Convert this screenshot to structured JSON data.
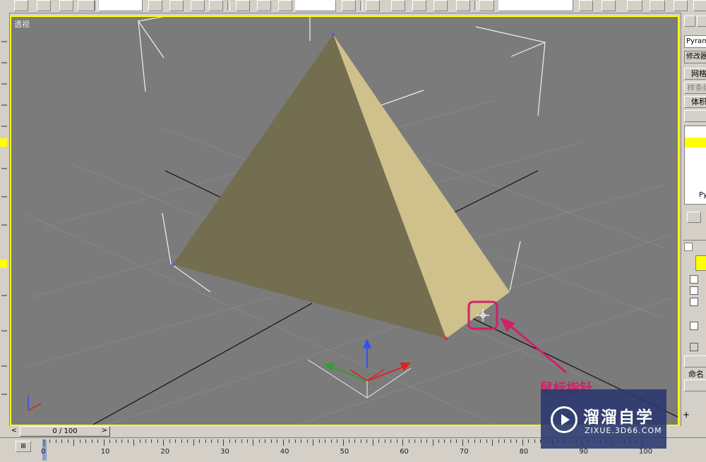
{
  "viewport": {
    "label": "透视"
  },
  "annotation": {
    "text": "鼠标指针"
  },
  "command_panel": {
    "object_name": "Pyramid",
    "modifier_list": "修改器",
    "buttons": [
      "网格",
      "样条线",
      "体积"
    ],
    "list_item": "Py",
    "section_label": "命名",
    "checkbox_labels": [
      "",
      "",
      "",
      "",
      ""
    ]
  },
  "time_slider": {
    "position": "0 / 100",
    "prev_icon": "arrow-left-icon",
    "next_icon": "arrow-right-icon"
  },
  "ruler": {
    "ticks": [
      "0",
      "10",
      "20",
      "30",
      "40",
      "50",
      "60",
      "70",
      "80",
      "90",
      "100"
    ]
  },
  "watermark": {
    "title": "溜溜自学",
    "subtitle": "ZIXUE.3D66.COM"
  },
  "colors": {
    "viewport_bg": "#7b7b7b",
    "viewport_border": "#ffff00",
    "pyramid_dark": "#746e50",
    "pyramid_light": "#cfc08c",
    "annotation": "#d0206a",
    "watermark_bg": "#2e3c6e"
  }
}
